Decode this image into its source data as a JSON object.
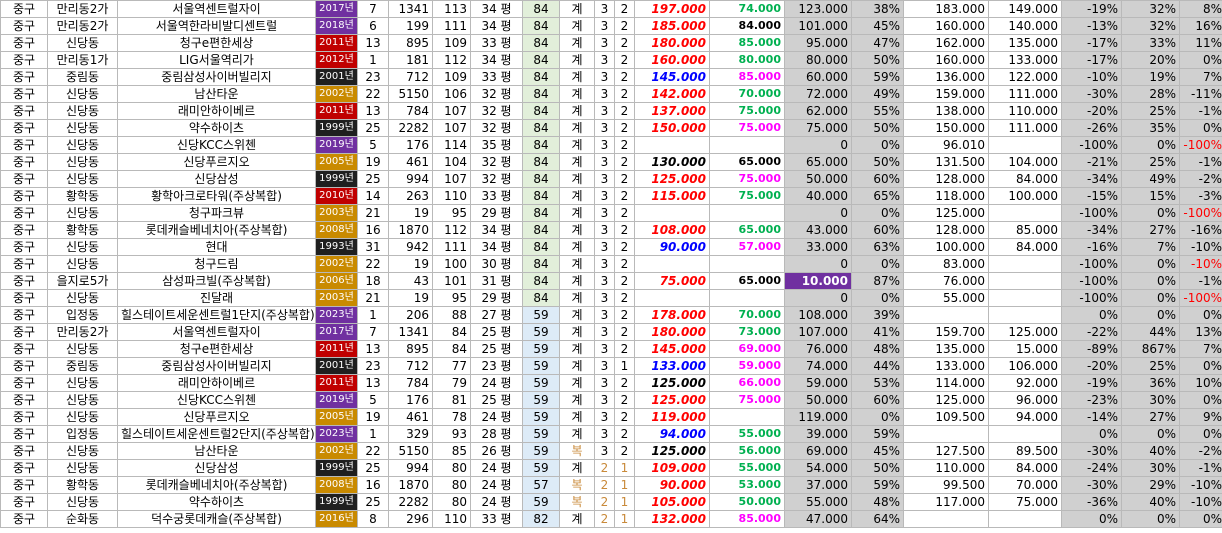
{
  "year_colors": {
    "2017": "#7030a0",
    "2018": "#7030a0",
    "2019": "#7030a0",
    "2023": "#7030a0",
    "2011": "#c00000",
    "2012": "#c00000",
    "2010": "#c00000",
    "2001": "#1f1f1f",
    "1999": "#1f1f1f",
    "1993": "#1f1f1f",
    "2002": "#c98a00",
    "2003": "#c98a00",
    "2005": "#c98a00",
    "2006": "#c98a00",
    "2008": "#c98a00",
    "2016": "#c98a00"
  },
  "price_colors": {
    "red": "#ff0000",
    "black": "#000000",
    "blue": "#0000ff"
  },
  "rows": [
    {
      "gu": "중구",
      "dong": "만리동2가",
      "name": "서울역센트럴자이",
      "year": "2017년",
      "yk": "2017",
      "c1": "7",
      "hh": "1341",
      "sz": "113",
      "py": "34 평",
      "area": "84",
      "sale": "계",
      "fl": "3",
      "rm": "2",
      "price": "197.000",
      "pc": "red",
      "dep": "74.000",
      "dc": "green",
      "v1": "123.000",
      "p1": "38%",
      "v2": "183.000",
      "v3": "149.000",
      "d1": "-19%",
      "d2": "32%",
      "d3": "8%",
      "areaCls": "p84"
    },
    {
      "gu": "중구",
      "dong": "만리동2가",
      "name": "서울역한라비발디센트럴",
      "year": "2018년",
      "yk": "2018",
      "c1": "6",
      "hh": "199",
      "sz": "111",
      "py": "34 평",
      "area": "84",
      "sale": "계",
      "fl": "3",
      "rm": "2",
      "price": "185.000",
      "pc": "red",
      "dep": "84.000",
      "dc": "black11",
      "v1": "101.000",
      "p1": "45%",
      "v2": "160.000",
      "v3": "140.000",
      "d1": "-13%",
      "d2": "32%",
      "d3": "16%",
      "areaCls": "p84"
    },
    {
      "gu": "중구",
      "dong": "신당동",
      "name": "청구e편한세상",
      "year": "2011년",
      "yk": "2011",
      "c1": "13",
      "hh": "895",
      "sz": "109",
      "py": "33 평",
      "area": "84",
      "sale": "계",
      "fl": "3",
      "rm": "2",
      "price": "180.000",
      "pc": "red",
      "dep": "85.000",
      "dc": "green",
      "v1": "95.000",
      "p1": "47%",
      "v2": "162.000",
      "v3": "135.000",
      "d1": "-17%",
      "d2": "33%",
      "d3": "11%",
      "areaCls": "p84"
    },
    {
      "gu": "중구",
      "dong": "만리동1가",
      "name": "LIG서울역리가",
      "year": "2012년",
      "yk": "2012",
      "c1": "1",
      "hh": "181",
      "sz": "112",
      "py": "34 평",
      "area": "84",
      "sale": "계",
      "fl": "3",
      "rm": "2",
      "price": "160.000",
      "pc": "red",
      "dep": "80.000",
      "dc": "green",
      "v1": "80.000",
      "p1": "50%",
      "v2": "160.000",
      "v3": "133.000",
      "d1": "-17%",
      "d2": "20%",
      "d3": "0%",
      "areaCls": "p84"
    },
    {
      "gu": "중구",
      "dong": "중림동",
      "name": "중림삼성사이버빌리지",
      "year": "2001년",
      "yk": "2001",
      "c1": "23",
      "hh": "712",
      "sz": "109",
      "py": "33 평",
      "area": "84",
      "sale": "계",
      "fl": "3",
      "rm": "2",
      "price": "145.000",
      "pc": "blue",
      "dep": "85.000",
      "dc": "magenta",
      "v1": "60.000",
      "p1": "59%",
      "v2": "136.000",
      "v3": "122.000",
      "d1": "-10%",
      "d2": "19%",
      "d3": "7%",
      "areaCls": "p84"
    },
    {
      "gu": "중구",
      "dong": "신당동",
      "name": "남산타운",
      "year": "2002년",
      "yk": "2002",
      "c1": "22",
      "hh": "5150",
      "sz": "106",
      "py": "32 평",
      "area": "84",
      "sale": "계",
      "fl": "3",
      "rm": "2",
      "price": "142.000",
      "pc": "red",
      "dep": "70.000",
      "dc": "green",
      "v1": "72.000",
      "p1": "49%",
      "v2": "159.000",
      "v3": "111.000",
      "d1": "-30%",
      "d2": "28%",
      "d3": "-11%",
      "areaCls": "p84"
    },
    {
      "gu": "중구",
      "dong": "신당동",
      "name": "래미안하이베르",
      "year": "2011년",
      "yk": "2011",
      "c1": "13",
      "hh": "784",
      "sz": "107",
      "py": "32 평",
      "area": "84",
      "sale": "계",
      "fl": "3",
      "rm": "2",
      "price": "137.000",
      "pc": "red",
      "dep": "75.000",
      "dc": "green",
      "v1": "62.000",
      "p1": "55%",
      "v2": "138.000",
      "v3": "110.000",
      "d1": "-20%",
      "d2": "25%",
      "d3": "-1%",
      "areaCls": "p84"
    },
    {
      "gu": "중구",
      "dong": "신당동",
      "name": "약수하이츠",
      "year": "1999년",
      "yk": "1999",
      "c1": "25",
      "hh": "2282",
      "sz": "107",
      "py": "32 평",
      "area": "84",
      "sale": "계",
      "fl": "3",
      "rm": "2",
      "price": "150.000",
      "pc": "red",
      "dep": "75.000",
      "dc": "magenta",
      "v1": "75.000",
      "p1": "50%",
      "v2": "150.000",
      "v3": "111.000",
      "d1": "-26%",
      "d2": "35%",
      "d3": "0%",
      "areaCls": "p84"
    },
    {
      "gu": "중구",
      "dong": "신당동",
      "name": "신당KCC스위첸",
      "year": "2019년",
      "yk": "2019",
      "c1": "5",
      "hh": "176",
      "sz": "114",
      "py": "35 평",
      "area": "84",
      "sale": "계",
      "fl": "3",
      "rm": "2",
      "price": "",
      "pc": "red",
      "dep": "",
      "dc": "green",
      "v1": "0",
      "p1": "0%",
      "v2": "96.010",
      "v3": "",
      "d1": "-100%",
      "d2": "0%",
      "d3": "-100%",
      "d3neg": true,
      "areaCls": "p84"
    },
    {
      "gu": "중구",
      "dong": "신당동",
      "name": "신당푸르지오",
      "year": "2005년",
      "yk": "2005",
      "c1": "19",
      "hh": "461",
      "sz": "104",
      "py": "32 평",
      "area": "84",
      "sale": "계",
      "fl": "3",
      "rm": "2",
      "price": "130.000",
      "pc": "black",
      "dep": "65.000",
      "dc": "black11",
      "v1": "65.000",
      "p1": "50%",
      "v2": "131.500",
      "v3": "104.000",
      "d1": "-21%",
      "d2": "25%",
      "d3": "-1%",
      "areaCls": "p84"
    },
    {
      "gu": "중구",
      "dong": "신당동",
      "name": "신당삼성",
      "year": "1999년",
      "yk": "1999",
      "c1": "25",
      "hh": "994",
      "sz": "107",
      "py": "32 평",
      "area": "84",
      "sale": "계",
      "fl": "3",
      "rm": "2",
      "price": "125.000",
      "pc": "red",
      "dep": "75.000",
      "dc": "magenta",
      "v1": "50.000",
      "p1": "60%",
      "v2": "128.000",
      "v3": "84.000",
      "d1": "-34%",
      "d2": "49%",
      "d3": "-2%",
      "areaCls": "p84"
    },
    {
      "gu": "중구",
      "dong": "황학동",
      "name": "황학아크로타워(주상복합)",
      "year": "2010년",
      "yk": "2010",
      "c1": "14",
      "hh": "263",
      "sz": "110",
      "py": "33 평",
      "area": "84",
      "sale": "계",
      "fl": "3",
      "rm": "2",
      "price": "115.000",
      "pc": "red",
      "dep": "75.000",
      "dc": "green",
      "v1": "40.000",
      "p1": "65%",
      "v2": "118.000",
      "v3": "100.000",
      "d1": "-15%",
      "d2": "15%",
      "d3": "-3%",
      "areaCls": "p84"
    },
    {
      "gu": "중구",
      "dong": "신당동",
      "name": "청구파크뷰",
      "year": "2003년",
      "yk": "2003",
      "c1": "21",
      "hh": "19",
      "sz": "95",
      "py": "29 평",
      "area": "84",
      "sale": "계",
      "fl": "3",
      "rm": "2",
      "price": "",
      "pc": "red",
      "dep": "",
      "dc": "green",
      "v1": "0",
      "p1": "0%",
      "v2": "125.000",
      "v3": "",
      "d1": "-100%",
      "d2": "0%",
      "d3": "-100%",
      "d3neg": true,
      "areaCls": "p84"
    },
    {
      "gu": "중구",
      "dong": "황학동",
      "name": "롯데캐슬베네치아(주상복합)",
      "year": "2008년",
      "yk": "2008",
      "c1": "16",
      "hh": "1870",
      "sz": "112",
      "py": "34 평",
      "area": "84",
      "sale": "계",
      "fl": "3",
      "rm": "2",
      "price": "108.000",
      "pc": "red",
      "dep": "65.000",
      "dc": "green",
      "v1": "43.000",
      "p1": "60%",
      "v2": "128.000",
      "v3": "85.000",
      "d1": "-34%",
      "d2": "27%",
      "d3": "-16%",
      "areaCls": "p84"
    },
    {
      "gu": "중구",
      "dong": "신당동",
      "name": "현대",
      "year": "1993년",
      "yk": "1993",
      "c1": "31",
      "hh": "942",
      "sz": "111",
      "py": "34 평",
      "area": "84",
      "sale": "계",
      "fl": "3",
      "rm": "2",
      "price": "90.000",
      "pc": "blue",
      "dep": "57.000",
      "dc": "magenta",
      "v1": "33.000",
      "p1": "63%",
      "v2": "100.000",
      "v3": "84.000",
      "d1": "-16%",
      "d2": "7%",
      "d3": "-10%",
      "areaCls": "p84"
    },
    {
      "gu": "중구",
      "dong": "신당동",
      "name": "청구드림",
      "year": "2002년",
      "yk": "2002",
      "c1": "22",
      "hh": "19",
      "sz": "100",
      "py": "30 평",
      "area": "84",
      "sale": "계",
      "fl": "3",
      "rm": "2",
      "price": "",
      "pc": "red",
      "dep": "",
      "dc": "green",
      "v1": "0",
      "p1": "0%",
      "v2": "83.000",
      "v3": "",
      "d1": "-100%",
      "d2": "0%",
      "d3": "-10%",
      "d3neg": true,
      "areaCls": "p84"
    },
    {
      "gu": "중구",
      "dong": "을지로5가",
      "name": "삼성파크빌(주상복합)",
      "year": "2006년",
      "yk": "2006",
      "c1": "18",
      "hh": "43",
      "sz": "101",
      "py": "31 평",
      "area": "84",
      "sale": "계",
      "fl": "3",
      "rm": "2",
      "price": "75.000",
      "pc": "red",
      "dep": "65.000",
      "dc": "black11",
      "v1": "10.000",
      "v1hl": true,
      "p1": "87%",
      "v2": "76.000",
      "v3": "",
      "d1": "-100%",
      "d2": "0%",
      "d3": "-1%",
      "areaCls": "p84"
    },
    {
      "gu": "중구",
      "dong": "신당동",
      "name": "진달래",
      "year": "2003년",
      "yk": "2003",
      "c1": "21",
      "hh": "19",
      "sz": "95",
      "py": "29 평",
      "area": "84",
      "sale": "계",
      "fl": "3",
      "rm": "2",
      "price": "",
      "pc": "red",
      "dep": "",
      "dc": "green",
      "v1": "0",
      "p1": "0%",
      "v2": "55.000",
      "v3": "",
      "d1": "-100%",
      "d2": "0%",
      "d3": "-100%",
      "d3neg": true,
      "areaCls": "p84"
    },
    {
      "gu": "중구",
      "dong": "입정동",
      "name": "힐스테이트세운센트럴1단지(주상복합)",
      "year": "2023년",
      "yk": "2023",
      "c1": "1",
      "hh": "206",
      "sz": "88",
      "py": "27 평",
      "area": "59",
      "sale": "계",
      "fl": "3",
      "rm": "2",
      "price": "178.000",
      "pc": "red",
      "dep": "70.000",
      "dc": "green",
      "v1": "108.000",
      "p1": "39%",
      "v2": "",
      "v3": "",
      "d1": "0%",
      "d2": "0%",
      "d3": "0%",
      "areaCls": "p59"
    },
    {
      "gu": "중구",
      "dong": "만리동2가",
      "name": "서울역센트럴자이",
      "year": "2017년",
      "yk": "2017",
      "c1": "7",
      "hh": "1341",
      "sz": "84",
      "py": "25 평",
      "area": "59",
      "sale": "계",
      "fl": "3",
      "rm": "2",
      "price": "180.000",
      "pc": "red",
      "dep": "73.000",
      "dc": "green",
      "v1": "107.000",
      "p1": "41%",
      "v2": "159.700",
      "v3": "125.000",
      "d1": "-22%",
      "d2": "44%",
      "d3": "13%",
      "areaCls": "p59"
    },
    {
      "gu": "중구",
      "dong": "신당동",
      "name": "청구e편한세상",
      "year": "2011년",
      "yk": "2011",
      "c1": "13",
      "hh": "895",
      "sz": "84",
      "py": "25 평",
      "area": "59",
      "sale": "계",
      "fl": "3",
      "rm": "2",
      "price": "145.000",
      "pc": "red",
      "dep": "69.000",
      "dc": "magenta",
      "v1": "76.000",
      "p1": "48%",
      "v2": "135.000",
      "v3": "15.000",
      "d1": "-89%",
      "d2": "867%",
      "d3": "7%",
      "areaCls": "p59"
    },
    {
      "gu": "중구",
      "dong": "중림동",
      "name": "중림삼성사이버빌리지",
      "year": "2001년",
      "yk": "2001",
      "c1": "23",
      "hh": "712",
      "sz": "77",
      "py": "23 평",
      "area": "59",
      "sale": "계",
      "fl": "3",
      "rm": "1",
      "price": "133.000",
      "pc": "blue",
      "dep": "59.000",
      "dc": "magenta",
      "v1": "74.000",
      "p1": "44%",
      "v2": "133.000",
      "v3": "106.000",
      "d1": "-20%",
      "d2": "25%",
      "d3": "0%",
      "areaCls": "p59"
    },
    {
      "gu": "중구",
      "dong": "신당동",
      "name": "래미안하이베르",
      "year": "2011년",
      "yk": "2011",
      "c1": "13",
      "hh": "784",
      "sz": "79",
      "py": "24 평",
      "area": "59",
      "sale": "계",
      "fl": "3",
      "rm": "2",
      "price": "125.000",
      "pc": "black",
      "dep": "66.000",
      "dc": "magenta",
      "v1": "59.000",
      "p1": "53%",
      "v2": "114.000",
      "v3": "92.000",
      "d1": "-19%",
      "d2": "36%",
      "d3": "10%",
      "areaCls": "p59"
    },
    {
      "gu": "중구",
      "dong": "신당동",
      "name": "신당KCC스위첸",
      "year": "2019년",
      "yk": "2019",
      "c1": "5",
      "hh": "176",
      "sz": "81",
      "py": "25 평",
      "area": "59",
      "sale": "계",
      "fl": "3",
      "rm": "2",
      "price": "125.000",
      "pc": "red",
      "dep": "75.000",
      "dc": "magenta",
      "v1": "50.000",
      "p1": "60%",
      "v2": "125.000",
      "v3": "96.000",
      "d1": "-23%",
      "d2": "30%",
      "d3": "0%",
      "areaCls": "p59"
    },
    {
      "gu": "중구",
      "dong": "신당동",
      "name": "신당푸르지오",
      "year": "2005년",
      "yk": "2005",
      "c1": "19",
      "hh": "461",
      "sz": "78",
      "py": "24 평",
      "area": "59",
      "sale": "계",
      "fl": "3",
      "rm": "2",
      "price": "119.000",
      "pc": "red",
      "dep": "",
      "dc": "green",
      "v1": "119.000",
      "p1": "0%",
      "v2": "109.500",
      "v3": "94.000",
      "d1": "-14%",
      "d2": "27%",
      "d3": "9%",
      "areaCls": "p59"
    },
    {
      "gu": "중구",
      "dong": "입정동",
      "name": "힐스테이트세운센트럴2단지(주상복합)",
      "year": "2023년",
      "yk": "2023",
      "c1": "1",
      "hh": "329",
      "sz": "93",
      "py": "28 평",
      "area": "59",
      "sale": "계",
      "fl": "3",
      "rm": "2",
      "price": "94.000",
      "pc": "blue",
      "dep": "55.000",
      "dc": "green",
      "v1": "39.000",
      "p1": "59%",
      "v2": "",
      "v3": "",
      "d1": "0%",
      "d2": "0%",
      "d3": "0%",
      "areaCls": "p59"
    },
    {
      "gu": "중구",
      "dong": "신당동",
      "name": "남산타운",
      "year": "2002년",
      "yk": "2002",
      "c1": "22",
      "hh": "5150",
      "sz": "85",
      "py": "26 평",
      "area": "59",
      "sale": "복",
      "fl": "3",
      "rm": "2",
      "price": "125.000",
      "pc": "black",
      "dep": "56.000",
      "dc": "green",
      "v1": "69.000",
      "p1": "45%",
      "v2": "127.500",
      "v3": "89.500",
      "d1": "-30%",
      "d2": "40%",
      "d3": "-2%",
      "areaCls": "p59",
      "lease": true
    },
    {
      "gu": "중구",
      "dong": "신당동",
      "name": "신당삼성",
      "year": "1999년",
      "yk": "1999",
      "c1": "25",
      "hh": "994",
      "sz": "80",
      "py": "24 평",
      "area": "59",
      "sale": "계",
      "fl": "2",
      "rm": "1",
      "price": "109.000",
      "pc": "red",
      "dep": "55.000",
      "dc": "green",
      "v1": "54.000",
      "p1": "50%",
      "v2": "110.000",
      "v3": "84.000",
      "d1": "-24%",
      "d2": "30%",
      "d3": "-1%",
      "areaCls": "p59",
      "flLease": true
    },
    {
      "gu": "중구",
      "dong": "황학동",
      "name": "롯데캐슬베네치아(주상복합)",
      "year": "2008년",
      "yk": "2008",
      "c1": "16",
      "hh": "1870",
      "sz": "80",
      "py": "24 평",
      "area": "57",
      "sale": "복",
      "fl": "2",
      "rm": "1",
      "price": "90.000",
      "pc": "red",
      "dep": "53.000",
      "dc": "green",
      "v1": "37.000",
      "p1": "59%",
      "v2": "99.500",
      "v3": "70.000",
      "d1": "-30%",
      "d2": "29%",
      "d3": "-10%",
      "areaCls": "p57",
      "lease": true,
      "flLease": true
    },
    {
      "gu": "중구",
      "dong": "신당동",
      "name": "약수하이츠",
      "year": "1999년",
      "yk": "1999",
      "c1": "25",
      "hh": "2282",
      "sz": "80",
      "py": "24 평",
      "area": "59",
      "sale": "복",
      "fl": "2",
      "rm": "1",
      "price": "105.000",
      "pc": "red",
      "dep": "50.000",
      "dc": "green",
      "v1": "55.000",
      "p1": "48%",
      "v2": "117.000",
      "v3": "75.000",
      "d1": "-36%",
      "d2": "40%",
      "d3": "-10%",
      "areaCls": "p59",
      "lease": true,
      "flLease": true
    },
    {
      "gu": "중구",
      "dong": "순화동",
      "name": "덕수궁롯데캐슬(주상복합)",
      "year": "2016년",
      "yk": "2016",
      "c1": "8",
      "hh": "296",
      "sz": "110",
      "py": "33 평",
      "area": "82",
      "sale": "계",
      "fl": "2",
      "rm": "1",
      "price": "132.000",
      "pc": "red",
      "dep": "85.000",
      "dc": "magenta",
      "v1": "47.000",
      "p1": "64%",
      "v2": "",
      "v3": "",
      "d1": "0%",
      "d2": "0%",
      "d3": "0%",
      "areaCls": "p59",
      "flLease": true
    }
  ]
}
